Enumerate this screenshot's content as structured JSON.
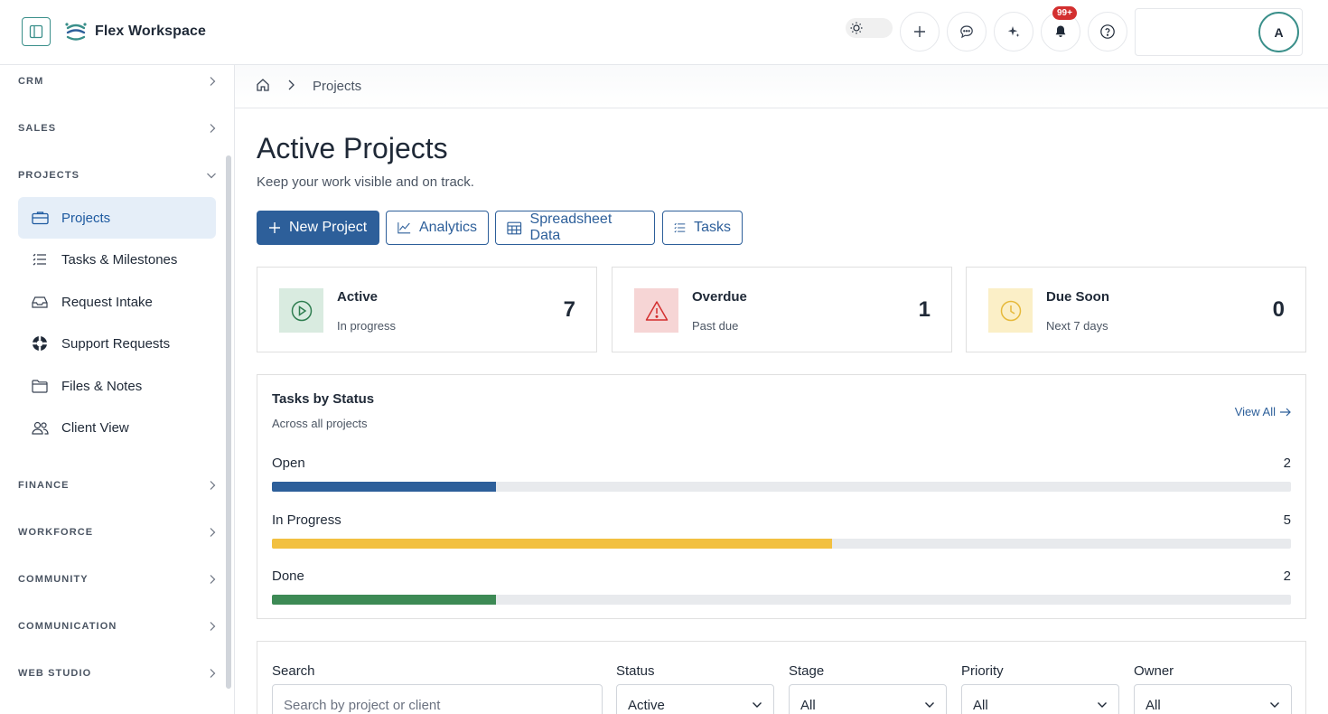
{
  "header": {
    "app_name": "Flex Workspace",
    "notifications_badge": "99+",
    "user_initial": "A"
  },
  "sidebar": {
    "sections": [
      {
        "label": "CRM"
      },
      {
        "label": "SALES"
      },
      {
        "label": "PROJECTS"
      },
      {
        "label": "FINANCE"
      },
      {
        "label": "WORKFORCE"
      },
      {
        "label": "COMMUNITY"
      },
      {
        "label": "COMMUNICATION"
      },
      {
        "label": "WEB STUDIO"
      }
    ],
    "project_items": [
      {
        "label": "Projects",
        "icon": "briefcase-icon",
        "active": true
      },
      {
        "label": "Tasks & Milestones",
        "icon": "list-icon"
      },
      {
        "label": "Request Intake",
        "icon": "inbox-icon"
      },
      {
        "label": "Support Requests",
        "icon": "lifebuoy-icon"
      },
      {
        "label": "Files & Notes",
        "icon": "folder-icon"
      },
      {
        "label": "Client View",
        "icon": "users-icon"
      }
    ]
  },
  "breadcrumb": {
    "current": "Projects"
  },
  "main": {
    "title": "Active Projects",
    "subtitle": "Keep your work visible and on track.",
    "actions": {
      "new_project": "New Project",
      "analytics": "Analytics",
      "spreadsheet": "Spreadsheet Data",
      "tasks": "Tasks"
    },
    "stats": [
      {
        "title": "Active",
        "sub": "In progress",
        "value": "7",
        "color": "#2e7d4f",
        "bg": "#d9ebe0"
      },
      {
        "title": "Overdue",
        "sub": "Past due",
        "value": "1",
        "color": "#d32f2f",
        "bg": "#f6d5d5"
      },
      {
        "title": "Due Soon",
        "sub": "Next 7 days",
        "value": "0",
        "color": "#e6b93a",
        "bg": "#fbefc7"
      }
    ],
    "status_panel": {
      "title": "Tasks by Status",
      "subtitle": "Across all projects",
      "view_all": "View All",
      "bars": [
        {
          "label": "Open",
          "count": "2",
          "fraction": 0.22,
          "color": "#2d5f9a"
        },
        {
          "label": "In Progress",
          "count": "5",
          "fraction": 0.55,
          "color": "#f2c040"
        },
        {
          "label": "Done",
          "count": "2",
          "fraction": 0.22,
          "color": "#3d8a55"
        }
      ]
    },
    "filters": {
      "search_label": "Search",
      "search_placeholder": "Search by project or client",
      "status_label": "Status",
      "status_value": "Active",
      "stage_label": "Stage",
      "stage_value": "All",
      "priority_label": "Priority",
      "priority_value": "All",
      "owner_label": "Owner",
      "owner_value": "All"
    }
  }
}
